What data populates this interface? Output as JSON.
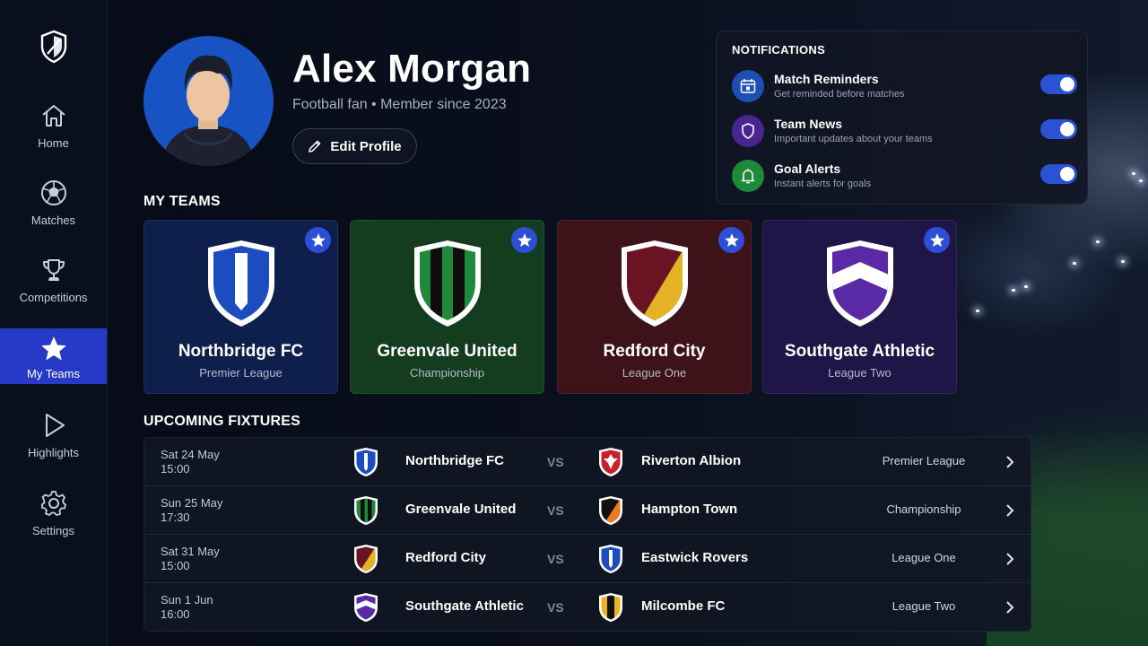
{
  "sidebar": {
    "items": [
      {
        "label": "Home",
        "icon": "home-icon"
      },
      {
        "label": "Matches",
        "icon": "football-icon"
      },
      {
        "label": "Competitions",
        "icon": "trophy-icon"
      },
      {
        "label": "My Teams",
        "icon": "star-icon",
        "active": true
      },
      {
        "label": "Highlights",
        "icon": "play-icon"
      },
      {
        "label": "Settings",
        "icon": "gear-icon"
      }
    ]
  },
  "profile": {
    "name": "Alex Morgan",
    "subtitle": "Football fan • Member since 2023",
    "edit_label": "Edit Profile"
  },
  "notifications": {
    "title": "NOTIFICATIONS",
    "items": [
      {
        "label": "Match Reminders",
        "desc": "Get reminded before matches",
        "icon": "calendar-icon",
        "icon_bg": "#1d4fb5",
        "enabled": true
      },
      {
        "label": "Team News",
        "desc": "Important updates about your teams",
        "icon": "shield-icon",
        "icon_bg": "#4a2590",
        "enabled": true
      },
      {
        "label": "Goal Alerts",
        "desc": "Instant alerts for goals",
        "icon": "bell-icon",
        "icon_bg": "#1d8a3a",
        "enabled": true
      }
    ]
  },
  "my_teams": {
    "title": "MY TEAMS",
    "teams": [
      {
        "name": "Northbridge FC",
        "league": "Premier League",
        "bg": "#0d1f4a",
        "favorite": true
      },
      {
        "name": "Greenvale United",
        "league": "Championship",
        "bg": "#143d1f",
        "favorite": true
      },
      {
        "name": "Redford City",
        "league": "League One",
        "bg": "#3d1218",
        "favorite": true
      },
      {
        "name": "Southgate Athletic",
        "league": "League Two",
        "bg": "#1f1547",
        "favorite": true
      }
    ]
  },
  "fixtures": {
    "title": "UPCOMING FIXTURES",
    "vs_label": "VS",
    "rows": [
      {
        "date": "Sat 24 May",
        "time": "15:00",
        "home": "Northbridge FC",
        "away": "Riverton Albion",
        "league": "Premier League"
      },
      {
        "date": "Sun 25 May",
        "time": "17:30",
        "home": "Greenvale United",
        "away": "Hampton Town",
        "league": "Championship"
      },
      {
        "date": "Sat 31 May",
        "time": "15:00",
        "home": "Redford City",
        "away": "Eastwick Rovers",
        "league": "League One"
      },
      {
        "date": "Sun 1 Jun",
        "time": "16:00",
        "home": "Southgate Athletic",
        "away": "Milcombe FC",
        "league": "League Two"
      }
    ]
  },
  "colors": {
    "accent": "#2d4fd6",
    "sidebar_active": "#2739c7",
    "toggle_on": "#2a52d4"
  }
}
